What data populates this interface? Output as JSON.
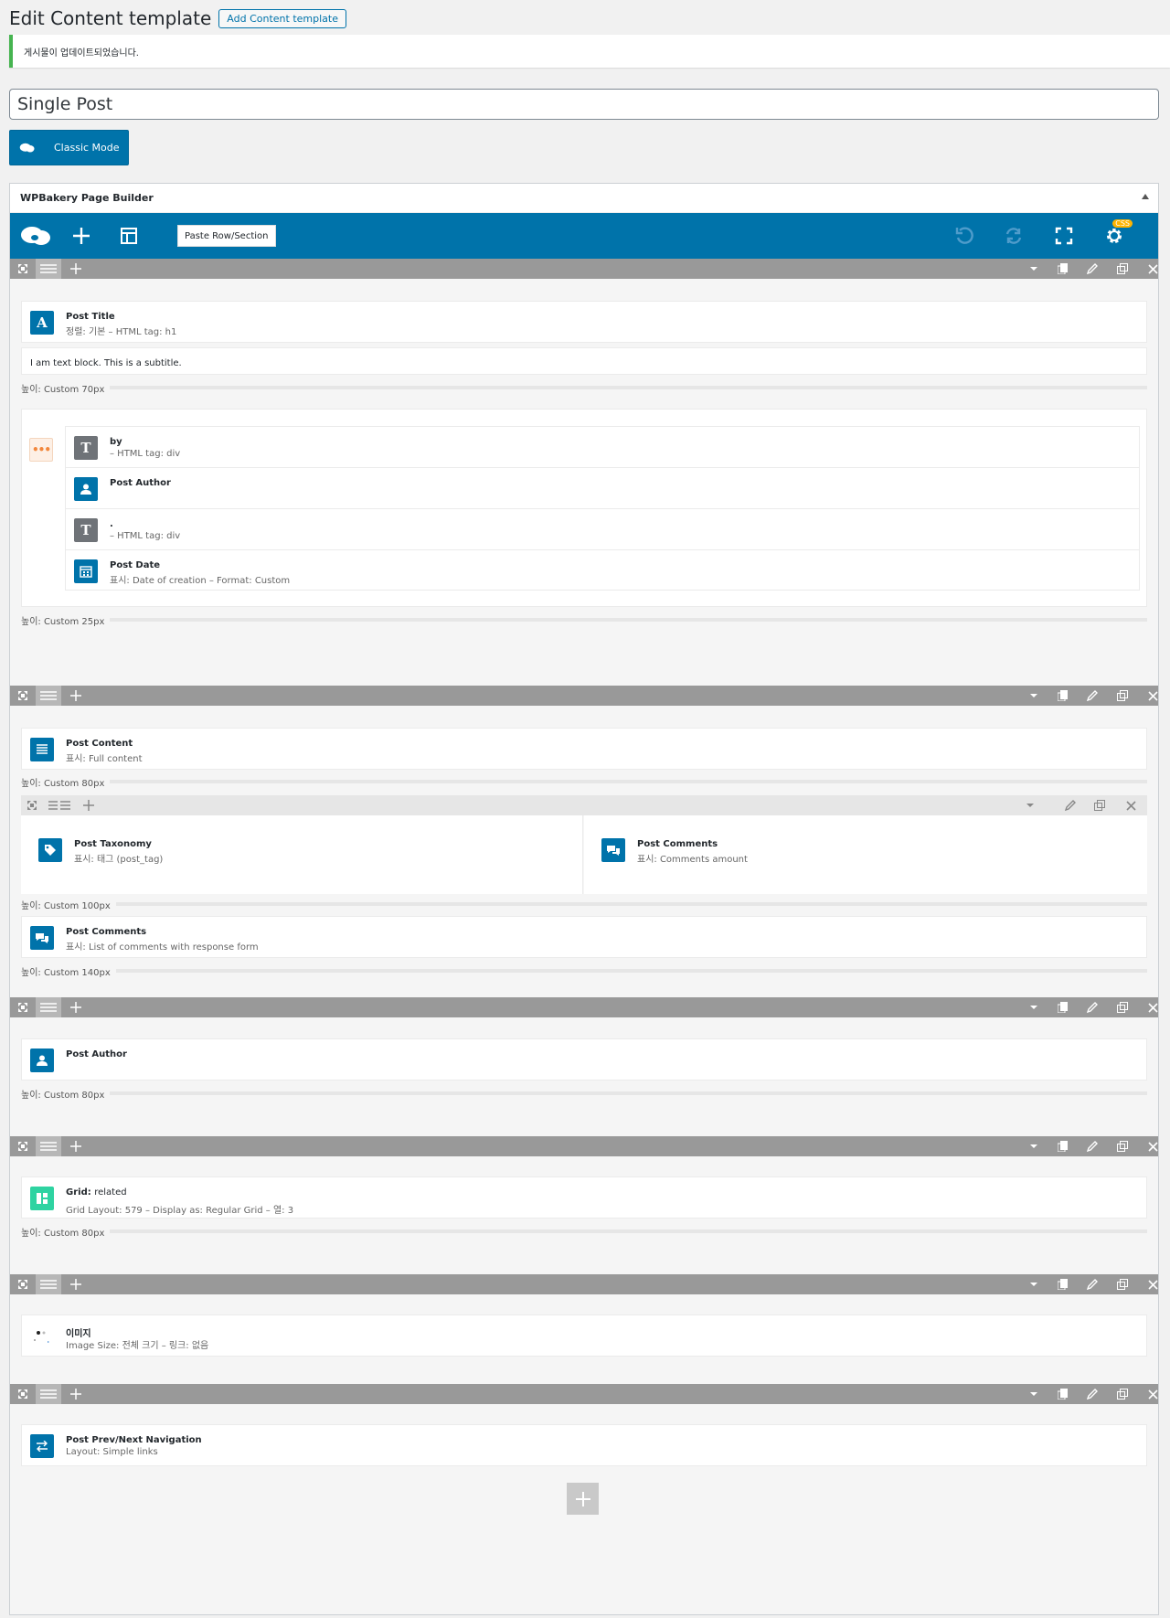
{
  "header": {
    "title": "Edit Content template",
    "add_label": "Add Content template"
  },
  "notice": {
    "text": "게시물이 업데이트되었습니다."
  },
  "post_title": {
    "value": "Single Post"
  },
  "classic_mode": {
    "label": "Classic Mode"
  },
  "builder": {
    "title": "WPBakery Page Builder",
    "paste_label": "Paste Row/Section",
    "css_badge": "CSS"
  },
  "rows": {
    "r1": {
      "post_title": {
        "name": "Post Title",
        "meta": "정렬: 기본  – HTML tag: h1"
      },
      "text_block": "I am text block. This is a subtitle.",
      "sep1": "높이: Custom  70px",
      "by": {
        "name": "by",
        "meta": "– HTML tag: div"
      },
      "author": {
        "name": "Post Author"
      },
      "dot": {
        "name": ".",
        "meta": "– HTML tag: div"
      },
      "date": {
        "name": "Post Date",
        "meta": "표시: Date of creation  – Format: Custom"
      },
      "sep2": "높이: Custom  25px"
    },
    "r2": {
      "content": {
        "name": "Post Content",
        "meta": "표시: Full content"
      },
      "sep1": "높이: Custom  80px",
      "taxonomy": {
        "name": "Post Taxonomy",
        "meta": "표시: 태그 (post_tag)"
      },
      "comments_amount": {
        "name": "Post Comments",
        "meta": "표시: Comments amount"
      },
      "sep2": "높이: Custom  100px",
      "comments_list": {
        "name": "Post Comments",
        "meta": "표시: List of comments with response form"
      },
      "sep3": "높이: Custom  140px"
    },
    "r3": {
      "author": {
        "name": "Post Author"
      },
      "sep1": "높이: Custom  80px"
    },
    "r4": {
      "grid": {
        "name": "Grid:",
        "name_value": "related",
        "meta": "Grid Layout: 579  – Display as: Regular Grid  – 열: 3"
      },
      "sep1": "높이: Custom  80px"
    },
    "r5": {
      "image": {
        "name": "이미지",
        "meta": "Image Size: 전체 크기  – 링크: 없음"
      }
    },
    "r6": {
      "nav": {
        "name": "Post Prev/Next Navigation",
        "meta": "Layout: Simple links"
      }
    }
  },
  "icons": {
    "row_controls": [
      "move-icon",
      "columns-icon",
      "add-column-icon",
      "toggle-icon",
      "copy-icon",
      "edit-icon",
      "clone-icon",
      "delete-icon"
    ],
    "navbar": [
      "wpbakery-logo-icon",
      "add-element-icon",
      "templates-icon",
      "undo-icon",
      "redo-icon",
      "fullscreen-icon",
      "settings-icon"
    ]
  },
  "colors": {
    "accent": "#0073aa",
    "row_bar": "#999999",
    "success": "#46b450",
    "grid_icon": "#2ed3a1",
    "badge": "#ffb400"
  }
}
